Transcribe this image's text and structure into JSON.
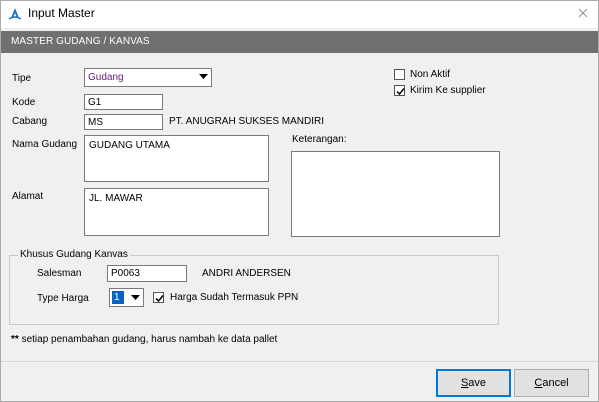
{
  "window": {
    "title": "Input Master"
  },
  "header": {
    "title": "MASTER  GUDANG / KANVAS"
  },
  "form": {
    "tipe": {
      "label": "Tipe",
      "value": "Gudang"
    },
    "kode": {
      "label": "Kode",
      "value": "G1"
    },
    "cabang": {
      "label": "Cabang",
      "value": "MS",
      "description": "PT. ANUGRAH SUKSES MANDIRI"
    },
    "nama_gudang": {
      "label": "Nama Gudang",
      "value": "GUDANG UTAMA"
    },
    "alamat": {
      "label": "Alamat",
      "value": "JL.  MAWAR"
    },
    "keterangan": {
      "label": "Keterangan:",
      "value": ""
    },
    "non_aktif": {
      "label": "Non Aktif",
      "checked": false
    },
    "kirim_ke_supplier": {
      "label": "Kirim Ke supplier",
      "checked": true
    }
  },
  "kanvas": {
    "legend": "Khusus Gudang Kanvas",
    "salesman": {
      "label": "Salesman",
      "value": "P0063",
      "name": "ANDRI ANDERSEN"
    },
    "type_harga": {
      "label": "Type Harga",
      "value": "1"
    },
    "harga_ppn": {
      "label": "Harga Sudah Termasuk PPN",
      "checked": true
    }
  },
  "note": {
    "prefix": "**",
    "text": " setiap penambahan gudang, harus nambah ke data pallet"
  },
  "buttons": {
    "save": {
      "first": "S",
      "rest": "ave"
    },
    "cancel": {
      "first": "C",
      "rest": "ancel"
    }
  },
  "colors": {
    "header_band": "#707070",
    "combo_value": "#6b1a7a",
    "selection": "#0a64c8",
    "default_button_border": "#0078d7"
  },
  "icons": {
    "app": "app-logo-icon",
    "close": "close-icon",
    "dropdown": "chevron-down-icon",
    "check": "checkmark-icon"
  }
}
